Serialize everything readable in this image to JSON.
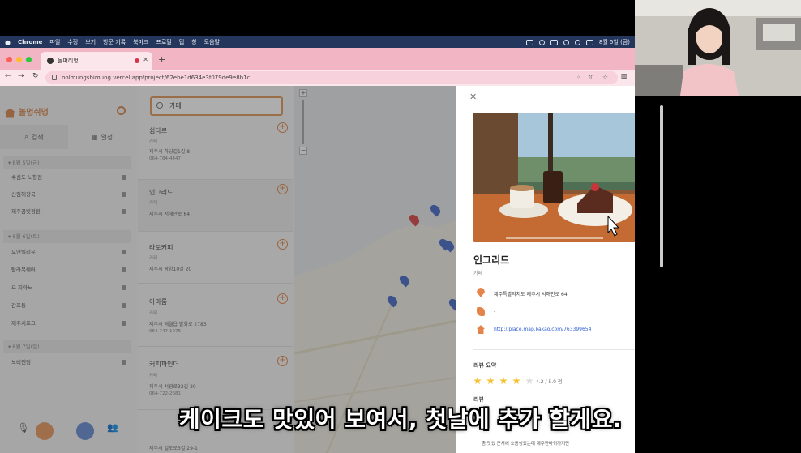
{
  "menubar": {
    "app": "Chrome",
    "items": [
      "파일",
      "수정",
      "보기",
      "방문 기록",
      "북마크",
      "프로필",
      "탭",
      "창",
      "도움말"
    ],
    "clock": "8월 5일 (금)"
  },
  "browser": {
    "tab_title": "놀며리멍",
    "url": "nolmungshimung.vercel.app/project/62ebe1d634e3f079de9e8b1c"
  },
  "sidebar": {
    "logo": "놀멍쉬멍",
    "search_tab": "검색",
    "plan_tab": "일정",
    "days": [
      {
        "title": "8월 5일(금)",
        "places": [
          "수심도 노형점",
          "신림해장국",
          "제주꿈빛정원"
        ]
      },
      {
        "title": "8월 6일(토)",
        "places": [
          "오연빌리유",
          "탐라목쉐어",
          "오 피아노",
          "감포동",
          "제주서포그"
        ]
      },
      {
        "title": "8월 7일(일)",
        "places": [
          "노비엔딩"
        ]
      }
    ]
  },
  "search": {
    "query": "카페"
  },
  "results": [
    {
      "name": "쉼타르",
      "category": "카페",
      "address": "제주시 하당길1길 8",
      "phone": "064-784-4447"
    },
    {
      "name": "인그리드",
      "category": "카페",
      "address": "제주시 서해안로 64",
      "phone": ""
    },
    {
      "name": "라도커피",
      "category": "카페",
      "address": "제주시 광양10길 20",
      "phone": ""
    },
    {
      "name": "아마룸",
      "category": "카페",
      "address": "제주시 애월읍 발화로 2783",
      "phone": "064-747-1076"
    },
    {
      "name": "커피파인더",
      "category": "카페",
      "address": "제주시 서광로32길 20",
      "phone": "064-722-2681"
    }
  ],
  "last_result_address": "제주시 일도로3길 29-1",
  "detail": {
    "name": "인그리드",
    "category": "카페",
    "address": "제주특별자치도 제주시 서해안로 64",
    "phone": "-",
    "link": "http://place.map.kakao.com/763399654",
    "review_summary_title": "리뷰 요약",
    "rating_text": "4.2 / 5.0 점",
    "rating": 4.2,
    "reviews_title": "리뷰",
    "review_snippet": "좀 맛있 근처에 소음성있는데 제주한바퀴까지만"
  },
  "subtitle": "케이크도 맛있어 보여서, 첫날에 추가 할게요.",
  "colors": {
    "accent": "#e4844a",
    "tab_bar": "#f1b5c4",
    "menubar": "#25365c",
    "pin": "#4a6cc9"
  }
}
